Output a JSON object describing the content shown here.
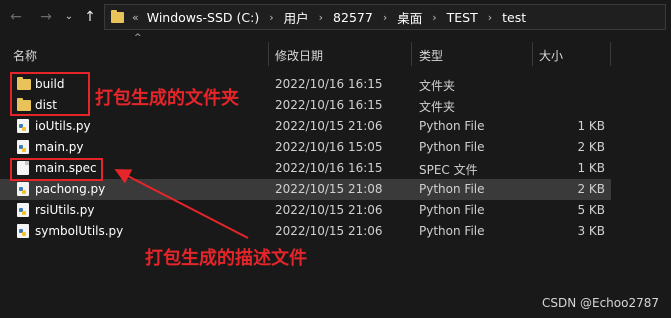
{
  "nav": {
    "back_icon": "arrow-left-icon",
    "forward_icon": "arrow-right-icon",
    "dropdown_icon": "chevron-down-icon",
    "up_icon": "arrow-up-icon"
  },
  "address": {
    "overflow": "«",
    "crumbs": [
      "Windows-SSD (C:)",
      "用户",
      "82577",
      "桌面",
      "TEST",
      "test"
    ]
  },
  "columns": {
    "name": "名称",
    "modified": "修改日期",
    "type": "类型",
    "size": "大小"
  },
  "files": [
    {
      "name": "build",
      "modified": "2022/10/16 16:15",
      "type": "文件夹",
      "size": "",
      "icon": "folder-icon"
    },
    {
      "name": "dist",
      "modified": "2022/10/16 16:15",
      "type": "文件夹",
      "size": "",
      "icon": "folder-icon"
    },
    {
      "name": "ioUtils.py",
      "modified": "2022/10/15 21:06",
      "type": "Python File",
      "size": "1 KB",
      "icon": "python-file-icon"
    },
    {
      "name": "main.py",
      "modified": "2022/10/16 15:05",
      "type": "Python File",
      "size": "2 KB",
      "icon": "python-file-icon"
    },
    {
      "name": "main.spec",
      "modified": "2022/10/16 16:15",
      "type": "SPEC 文件",
      "size": "1 KB",
      "icon": "document-icon"
    },
    {
      "name": "pachong.py",
      "modified": "2022/10/15 21:08",
      "type": "Python File",
      "size": "2 KB",
      "icon": "python-file-icon"
    },
    {
      "name": "rsiUtils.py",
      "modified": "2022/10/15 21:06",
      "type": "Python File",
      "size": "5 KB",
      "icon": "python-file-icon"
    },
    {
      "name": "symbolUtils.py",
      "modified": "2022/10/15 21:06",
      "type": "Python File",
      "size": "3 KB",
      "icon": "python-file-icon"
    }
  ],
  "annotations": {
    "folders_note": "打包生成的文件夹",
    "spec_note": "打包生成的描述文件",
    "color": "#e5252a"
  },
  "watermark": "CSDN @Echoo2787"
}
